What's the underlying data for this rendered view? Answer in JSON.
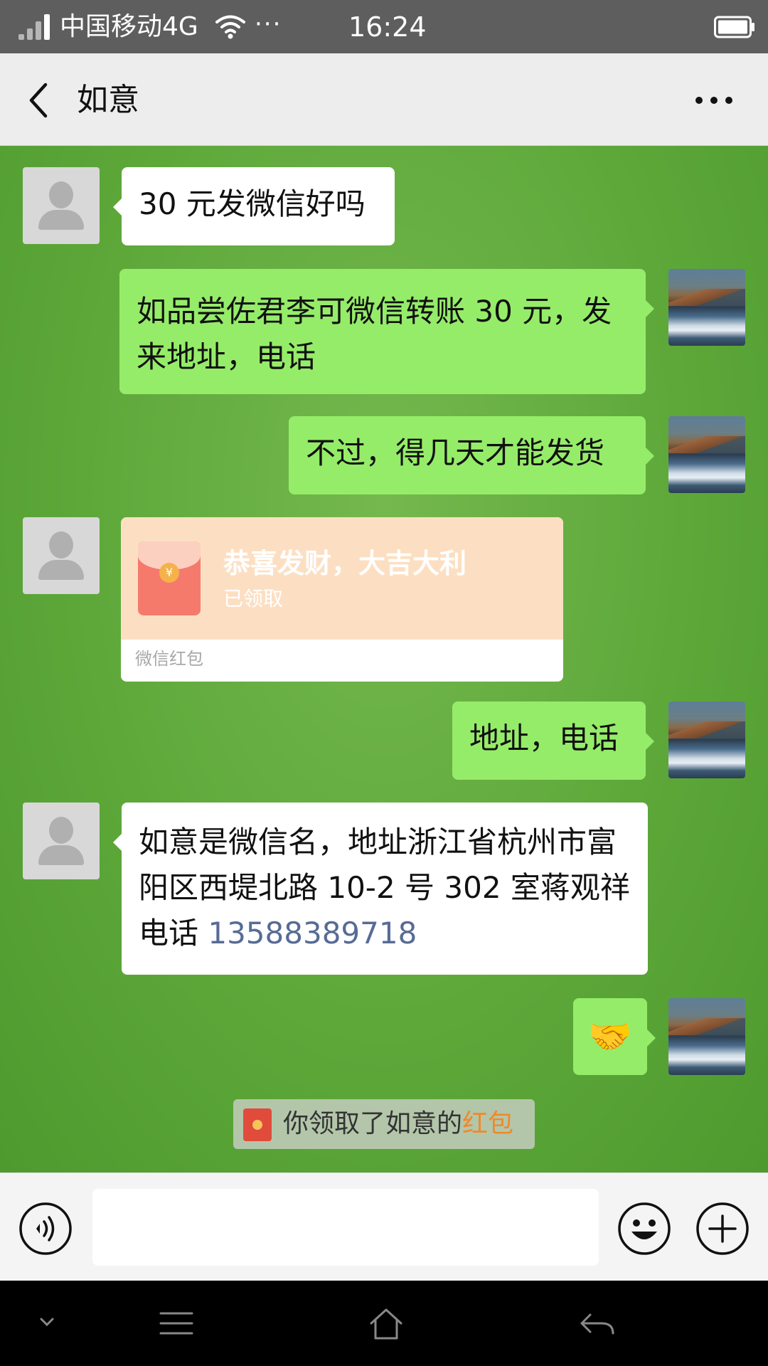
{
  "status_bar": {
    "carrier": "中国移动4G",
    "more": "···",
    "time": "16:24"
  },
  "title_bar": {
    "title": "如意"
  },
  "messages": [
    {
      "side": "left",
      "text": "30 元发微信好吗"
    },
    {
      "side": "right",
      "text": "如品尝佐君李可微信转账 30 元，发来地址，电话"
    },
    {
      "side": "right",
      "text": "不过，得几天才能发货"
    },
    {
      "side": "left",
      "type": "red_packet",
      "title": "恭喜发财，大吉大利",
      "status": "已领取",
      "footer": "微信红包"
    },
    {
      "side": "right",
      "text": "地址，电话"
    },
    {
      "side": "left",
      "text": "如意是微信名，地址浙江省杭州市富阳区西堤北路 10-2 号 302 室蒋观祥电话 ",
      "phone": "13588389718"
    },
    {
      "side": "right",
      "type": "emoji",
      "emoji": "🤝",
      "icon": "handshake-icon"
    }
  ],
  "system_notice": {
    "text": "你领取了如意的",
    "link": "红包"
  },
  "input_bar": {
    "value": ""
  },
  "colors": {
    "bubble_right": "#95ec69",
    "bubble_left": "#ffffff",
    "red_packet_bg": "#fcdfc2",
    "link": "#576b95",
    "notice_link": "#f0892a"
  }
}
